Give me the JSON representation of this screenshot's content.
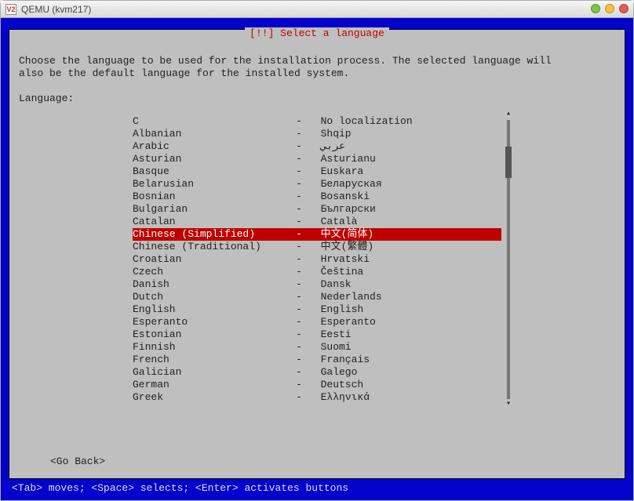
{
  "window": {
    "app_icon_text": "V2",
    "title": "QEMU (kvm217)"
  },
  "dialog": {
    "title": "[!!] Select a language",
    "description": "Choose the language to be used for the installation process. The selected language will\nalso be the default language for the installed system.",
    "label": "Language:",
    "go_back": "<Go Back>",
    "selected_index": 9,
    "languages": [
      {
        "name": "C",
        "native": "No localization"
      },
      {
        "name": "Albanian",
        "native": "Shqip"
      },
      {
        "name": "Arabic",
        "native": "عربي"
      },
      {
        "name": "Asturian",
        "native": "Asturianu"
      },
      {
        "name": "Basque",
        "native": "Euskara"
      },
      {
        "name": "Belarusian",
        "native": "Беларуская"
      },
      {
        "name": "Bosnian",
        "native": "Bosanski"
      },
      {
        "name": "Bulgarian",
        "native": "Български"
      },
      {
        "name": "Catalan",
        "native": "Català"
      },
      {
        "name": "Chinese (Simplified)",
        "native": "中文(简体)"
      },
      {
        "name": "Chinese (Traditional)",
        "native": "中文(繁體)"
      },
      {
        "name": "Croatian",
        "native": "Hrvatski"
      },
      {
        "name": "Czech",
        "native": "Čeština"
      },
      {
        "name": "Danish",
        "native": "Dansk"
      },
      {
        "name": "Dutch",
        "native": "Nederlands"
      },
      {
        "name": "English",
        "native": "English"
      },
      {
        "name": "Esperanto",
        "native": "Esperanto"
      },
      {
        "name": "Estonian",
        "native": "Eesti"
      },
      {
        "name": "Finnish",
        "native": "Suomi"
      },
      {
        "name": "French",
        "native": "Français"
      },
      {
        "name": "Galician",
        "native": "Galego"
      },
      {
        "name": "German",
        "native": "Deutsch"
      },
      {
        "name": "Greek",
        "native": "Ελληνικά"
      }
    ]
  },
  "statusbar": "<Tab> moves; <Space> selects; <Enter> activates buttons"
}
